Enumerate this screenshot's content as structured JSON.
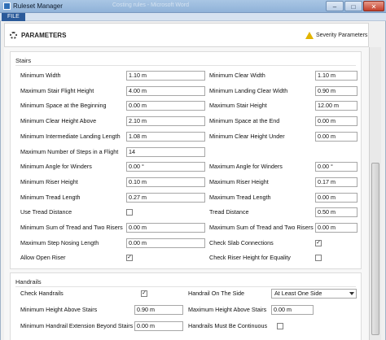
{
  "window": {
    "title": "Ruleset Manager",
    "background_title": "Costing rules - Microsoft Word",
    "min": "–",
    "max": "□",
    "close": "✕"
  },
  "menu": {
    "file": "FILE"
  },
  "params": {
    "title": "PARAMETERS",
    "severity": "Severity Parameters"
  },
  "stairs": {
    "title": "Stairs",
    "rows": [
      {
        "left_label": "Minimum Width",
        "left_value": "1.10 m",
        "right_label": "Minimum Clear Width",
        "right_value": "1.10 m"
      },
      {
        "left_label": "Maximum Stair Flight Height",
        "left_value": "4.00 m",
        "right_label": "Minimum Landing Clear Width",
        "right_value": "0.90 m"
      },
      {
        "left_label": "Minimum Space at the Beginning",
        "left_value": "0.00 m",
        "right_label": "Maximum Stair Height",
        "right_value": "12.00 m"
      },
      {
        "left_label": "Minimum Clear Height Above",
        "left_value": "2.10 m",
        "right_label": "Minimum Space at the End",
        "right_value": "0.00 m"
      },
      {
        "left_label": "Minimum Intermediate Landing Length",
        "left_value": "1.08 m",
        "right_label": "Minimum Clear Height Under",
        "right_value": "0.00 m"
      },
      {
        "left_label": "Maximum Number of Steps in a Flight",
        "left_value": "14"
      },
      {
        "left_label": "Minimum Angle for Winders",
        "left_value": "0.00 °",
        "right_label": "Maximum Angle for Winders",
        "right_value": "0.00 °"
      },
      {
        "left_label": "Minimum Riser Height",
        "left_value": "0.10 m",
        "right_label": "Maximum Riser Height",
        "right_value": "0.17 m"
      },
      {
        "left_label": "Minimum Tread Length",
        "left_value": "0.27 m",
        "right_label": "Maximum Tread Length",
        "right_value": "0.00 m"
      },
      {
        "left_label": "Use Tread Distance",
        "left_check": "",
        "right_label": "Tread Distance",
        "right_value": "0.50 m"
      },
      {
        "left_label": "Minimum Sum of Tread and Two Risers",
        "left_value": "0.00 m",
        "right_label": "Maximum Sum of Tread and Two Risers",
        "right_value": "0.00 m"
      },
      {
        "left_label": "Maximum Step Nosing Length",
        "left_value": "0.00 m",
        "right_label": "Check Slab Connections",
        "right_check": "✓"
      },
      {
        "left_label": "Allow Open Riser",
        "left_check": "✓",
        "right_label": "Check Riser Height for Equality",
        "right_check": ""
      }
    ]
  },
  "handrails": {
    "title": "Handrails",
    "rows": [
      {
        "left_label": "Check Handrails",
        "left_check": "✓",
        "right_label": "Handrail On The Side",
        "right_select": "At Least One Side"
      },
      {
        "left_label": "Minimum Height Above Stairs",
        "left_value": "0.90 m",
        "right_label": "Maximum Height Above Stairs",
        "right_value": "0.00 m"
      },
      {
        "left_label": "Minimum Handrail Extension Beyond Stairs",
        "left_value": "0.00 m",
        "right_label": "Handrails Must Be Continuous",
        "right_check": ""
      }
    ]
  }
}
